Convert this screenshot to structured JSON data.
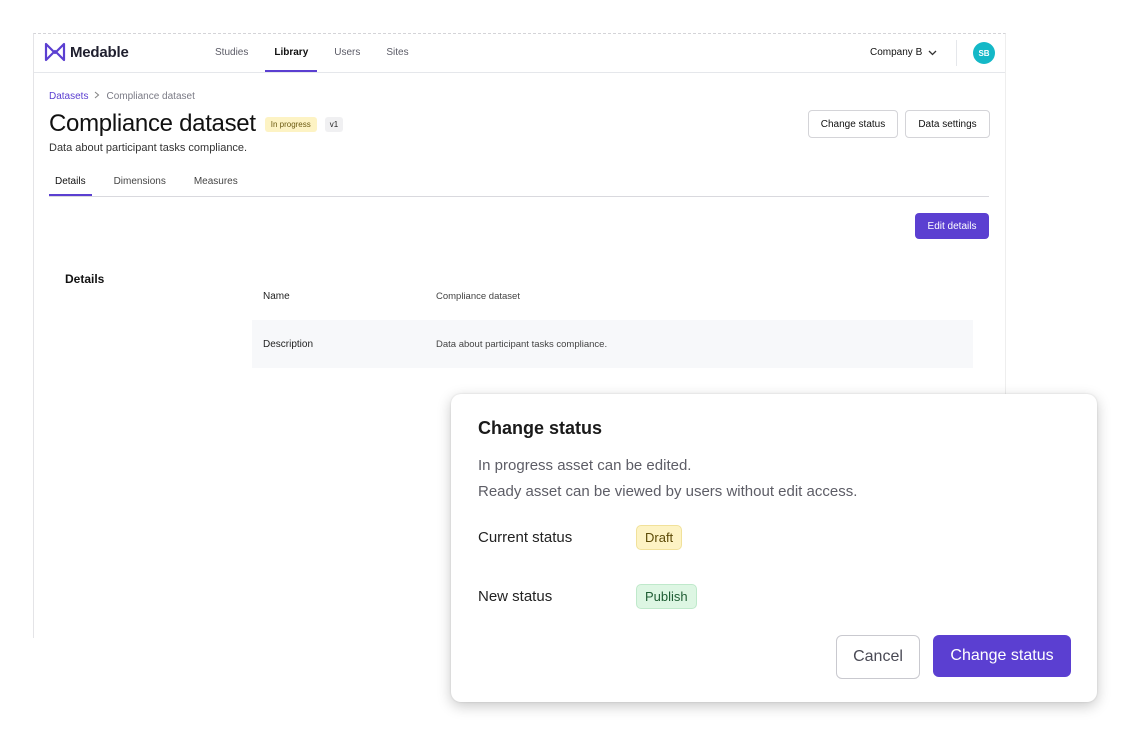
{
  "nav": {
    "logo_text": "Medable",
    "links": [
      {
        "label": "Studies"
      },
      {
        "label": "Library"
      },
      {
        "label": "Users"
      },
      {
        "label": "Sites"
      }
    ],
    "active_link": "Library",
    "company": "Company B",
    "avatar_initials": "SB"
  },
  "breadcrumb": {
    "parent": "Datasets",
    "current": "Compliance dataset"
  },
  "page": {
    "title": "Compliance dataset",
    "status_badge": "In progress",
    "version_badge": "v1",
    "subtitle": "Data about participant tasks compliance.",
    "change_status_label": "Change status",
    "data_settings_label": "Data settings",
    "edit_details_label": "Edit details"
  },
  "tabs": [
    {
      "label": "Details"
    },
    {
      "label": "Dimensions"
    },
    {
      "label": "Measures"
    }
  ],
  "active_tab": "Details",
  "details": {
    "section_title": "Details",
    "rows": [
      {
        "label": "Name",
        "value": "Compliance dataset"
      },
      {
        "label": "Description",
        "value": "Data about participant tasks compliance."
      }
    ]
  },
  "modal": {
    "title": "Change status",
    "desc_line1": "In progress asset can be edited.",
    "desc_line2": "Ready asset can be viewed by users without edit access.",
    "current_label": "Current status",
    "current_value": "Draft",
    "new_label": "New status",
    "new_value": "Publish",
    "cancel_label": "Cancel",
    "confirm_label": "Change status"
  },
  "colors": {
    "accent": "#5b3fd1",
    "avatar": "#14b8c7",
    "badge_yellow": "#fdf3c4",
    "badge_green": "#ddf6e3"
  },
  "icons": {
    "logo": "medable-logo-icon",
    "breadcrumb_separator": "chevron-right-icon",
    "company_dropdown": "chevron-down-icon"
  }
}
